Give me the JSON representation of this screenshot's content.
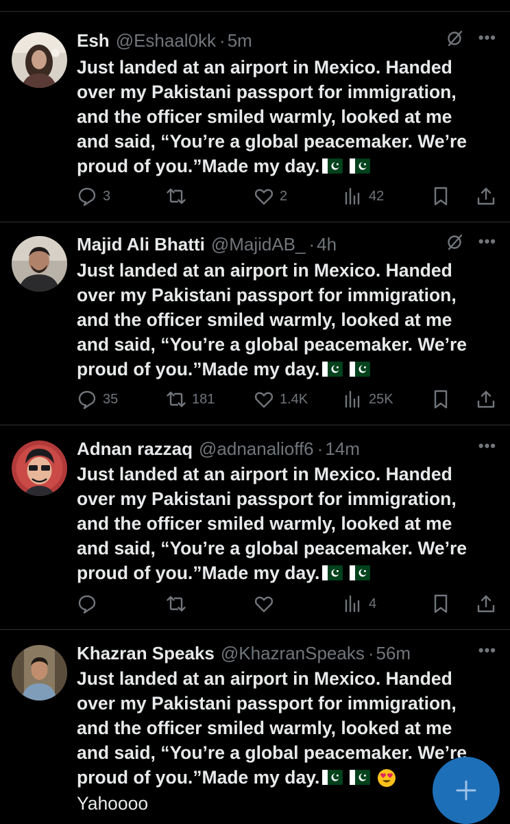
{
  "tweets": [
    {
      "name": "Esh",
      "handle": "@Eshaal0kk",
      "time": "5m",
      "text": "Just landed at an airport in Mexico. Handed over my Pakistani passport for immigration, and the officer smiled warmly, looked at me and said, “You’re a global peacemaker. We’re proud of you.”Made my day.",
      "extra": "",
      "replies": "3",
      "retweets": "",
      "likes": "2",
      "views": "42"
    },
    {
      "name": "Majid Ali Bhatti",
      "handle": "@MajidAB_",
      "time": "4h",
      "text": "Just landed at an airport in Mexico. Handed over my Pakistani passport for immigration, and the officer smiled warmly, looked at me and said, “You’re a global peacemaker. We’re proud of you.”Made my day.",
      "extra": "",
      "replies": "35",
      "retweets": "181",
      "likes": "1.4K",
      "views": "25K"
    },
    {
      "name": "Adnan razzaq",
      "handle": "@adnanalioff6",
      "time": "14m",
      "text": "Just landed at an airport in Mexico. Handed over my Pakistani passport for immigration, and the officer smiled warmly, looked at me and said, “You’re a global peacemaker. We’re proud of you.”Made my day.",
      "extra": "",
      "replies": "",
      "retweets": "",
      "likes": "",
      "views": "4"
    },
    {
      "name": "Khazran Speaks",
      "handle": "@KhazranSpeaks",
      "time": "56m",
      "text": "Just landed at an airport in Mexico. Handed over my Pakistani passport for immigration, and the officer smiled warmly, looked at me and said, “You’re a global peacemaker. We’re proud of you.”Made my day.",
      "extra": "Yahoooo",
      "replies": "",
      "retweets": "",
      "likes": "",
      "views": ""
    }
  ],
  "dot_separator": "·",
  "more_glyph": "•••",
  "compose_glyph": "+",
  "icons": [
    "grok-icon",
    "more-icon",
    "reply-icon",
    "retweet-icon",
    "like-icon",
    "views-icon",
    "bookmark-icon",
    "share-icon",
    "pakistan-flag-icon",
    "heart-eyes-emoji-icon",
    "compose-icon"
  ],
  "colors": {
    "background": "#000000",
    "text": "#e7e9ea",
    "muted": "#71767b",
    "divider": "#2f3336",
    "fab": "#1d6fb8",
    "flag_green": "#01411c"
  }
}
